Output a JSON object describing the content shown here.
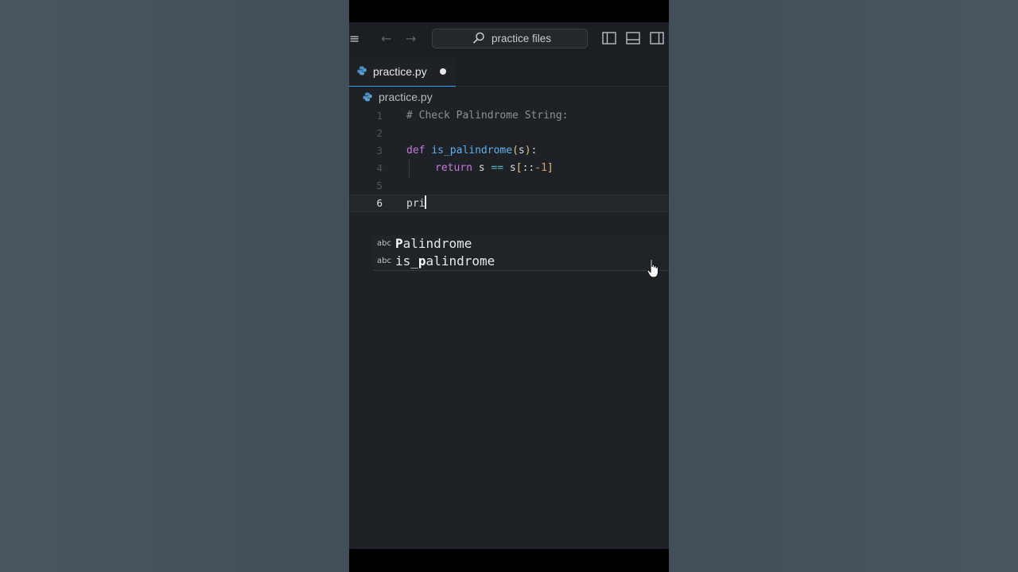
{
  "search": {
    "label": "practice files"
  },
  "tabs": [
    {
      "label": "practice.py",
      "modified": true
    }
  ],
  "breadcrumb": {
    "label": "practice.py"
  },
  "editor": {
    "lines": [
      {
        "number": "1",
        "text": "# Check Palindrome String:"
      },
      {
        "number": "2",
        "text": ""
      },
      {
        "number": "3",
        "text": "def is_palindrome(s):"
      },
      {
        "number": "4",
        "text": "return s == s[::-1]"
      },
      {
        "number": "5",
        "text": ""
      },
      {
        "number": "6",
        "text": "pri"
      }
    ],
    "current_line": "6"
  },
  "suggestions": [
    {
      "kind": "abc",
      "label": "Palindrome"
    },
    {
      "kind": "abc",
      "label": "is_palindrome"
    }
  ],
  "colors": {
    "accent": "#3a9fff",
    "keyword": "#c678dd",
    "function": "#61afef",
    "number": "#d19a66",
    "comment": "#8a9097"
  }
}
